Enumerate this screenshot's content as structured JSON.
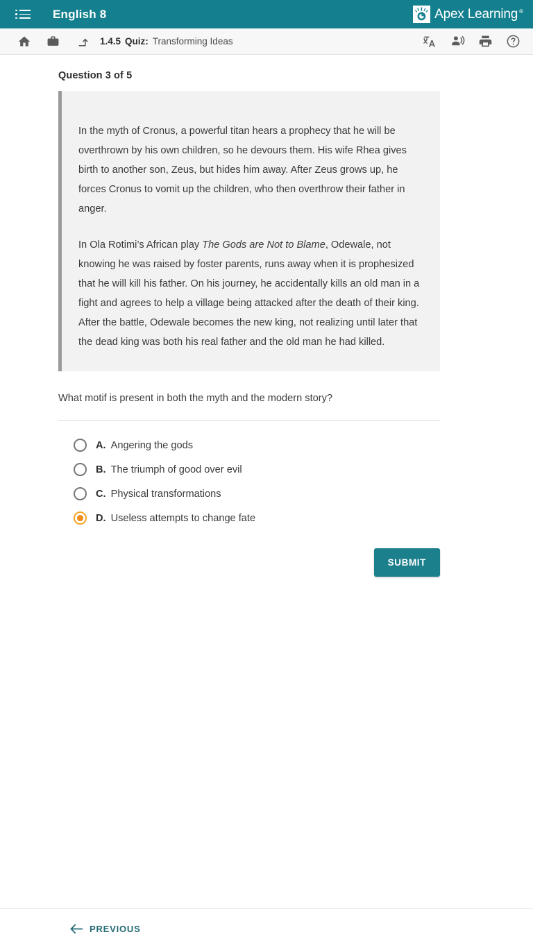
{
  "header": {
    "menu_icon": "list-menu-icon",
    "course_title": "English 8",
    "brand_name": "Apex Learning",
    "brand_tm": "®",
    "brand_mark_icon": "apex-torch-logo-icon",
    "accent_teal": "#14808f"
  },
  "toolbar": {
    "home_icon": "home-icon",
    "briefcase_icon": "briefcase-icon",
    "up_level_icon": "up-level-arrow-icon",
    "translate_icon": "translate-icon",
    "read_aloud_icon": "read-aloud-icon",
    "print_icon": "print-icon",
    "help_icon": "help-icon",
    "breadcrumb": {
      "number": "1.4.5",
      "type": "Quiz:",
      "name": "Transforming Ideas"
    }
  },
  "main": {
    "question_counter": "Question 3 of 5",
    "passage": {
      "paragraph_1": "In the myth of Cronus, a powerful titan hears a prophecy that he will be overthrown by his own children, so he devours them. His wife Rhea gives birth to another son, Zeus, but hides him away. After Zeus grows up, he forces Cronus to vomit up the children, who then overthrow their father in anger.",
      "paragraph_2_pre": "In Ola Rotimi’s African play ",
      "paragraph_2_title": "The Gods are Not to Blame",
      "paragraph_2_post": ", Odewale, not knowing he was raised by foster parents, runs away when it is prophesized that he will kill his father. On his journey, he accidentally kills an old man in a fight and agrees to help a village being attacked after the death of their king. After the battle, Odewale becomes the new king, not realizing until later that the dead king was both his real father and the old man he had killed."
    },
    "prompt": "What motif is present in both the myth and the modern story?",
    "options": [
      {
        "letter": "A.",
        "text": "Angering the gods",
        "selected": false
      },
      {
        "letter": "B.",
        "text": "The triumph of good over evil",
        "selected": false
      },
      {
        "letter": "C.",
        "text": "Physical transformations",
        "selected": false
      },
      {
        "letter": "D.",
        "text": "Useless attempts to change fate",
        "selected": true
      }
    ],
    "selected_option": "D",
    "selected_color": "#f08c1b",
    "submit_label": "SUBMIT",
    "submit_color": "#1b7f8c"
  },
  "footer": {
    "previous_label": "PREVIOUS",
    "previous_icon": "arrow-left-icon",
    "link_color": "#246b75"
  }
}
